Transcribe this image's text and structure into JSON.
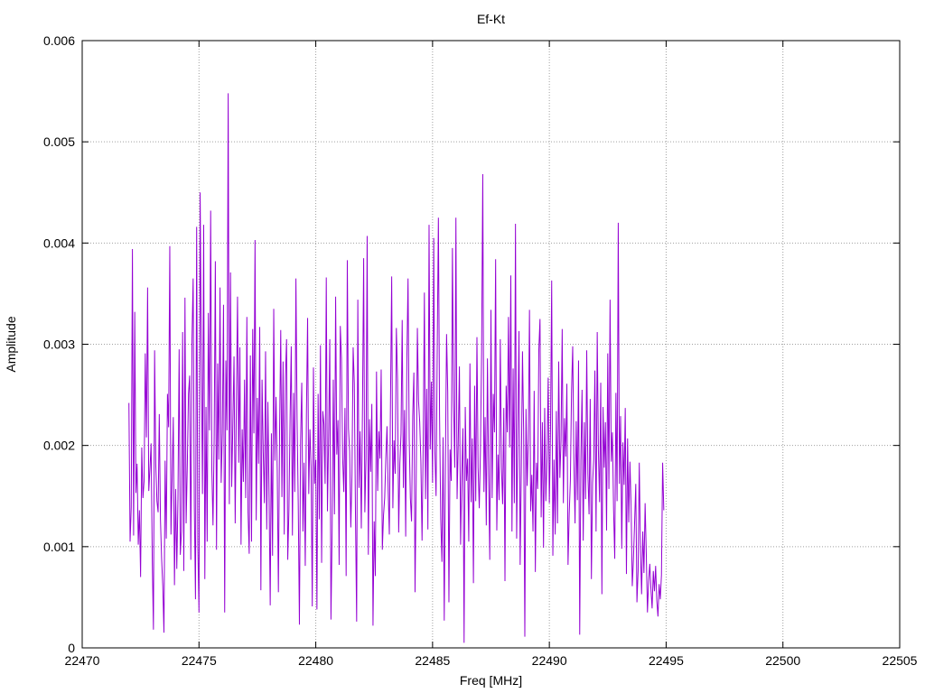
{
  "chart_data": {
    "type": "line",
    "title": "Ef-Kt",
    "xlabel": "Freq [MHz]",
    "ylabel": "Amplitude",
    "xlim": [
      22470,
      22505
    ],
    "ylim": [
      0,
      0.006
    ],
    "x_ticks": [
      "22470",
      "22475",
      "22480",
      "22485",
      "22490",
      "22495",
      "22500",
      "22505"
    ],
    "y_ticks": [
      "0",
      "0.001",
      "0.002",
      "0.003",
      "0.004",
      "0.005",
      "0.006"
    ],
    "grid": true,
    "legend": "none",
    "series": [
      {
        "color": "#9400d3",
        "x_start": 22472.0,
        "x_step": 0.05,
        "values": [
          0.00242,
          0.00105,
          0.00139,
          0.00394,
          0.00111,
          0.00332,
          0.00153,
          0.00182,
          0.00102,
          0.00136,
          0.0007,
          0.00198,
          0.00148,
          0.00165,
          0.00291,
          0.00208,
          0.00356,
          0.00155,
          0.00177,
          0.00202,
          0.00086,
          0.00018,
          0.00294,
          0.00181,
          0.00145,
          0.00134,
          0.00231,
          0.00127,
          0.00088,
          0.00061,
          0.00015,
          0.00185,
          0.00108,
          0.00251,
          0.00218,
          0.00397,
          0.00112,
          0.00168,
          0.00228,
          0.00062,
          0.00157,
          0.00078,
          0.00148,
          0.00295,
          0.00092,
          0.00115,
          0.00312,
          0.00076,
          0.00346,
          0.00123,
          0.00181,
          0.00251,
          0.00269,
          0.00087,
          0.00305,
          0.00365,
          0.00141,
          0.00048,
          0.00416,
          0.00102,
          0.00035,
          0.0045,
          0.00287,
          0.00152,
          0.00418,
          0.00068,
          0.00238,
          0.00105,
          0.00331,
          0.00215,
          0.00432,
          0.00176,
          0.00121,
          0.00208,
          0.00382,
          0.00097,
          0.00281,
          0.00186,
          0.00356,
          0.00163,
          0.00212,
          0.00339,
          0.00035,
          0.00284,
          0.00215,
          0.00548,
          0.00142,
          0.00371,
          0.00159,
          0.00221,
          0.00288,
          0.00123,
          0.00241,
          0.00347,
          0.00183,
          0.00297,
          0.00102,
          0.00216,
          0.00164,
          0.00265,
          0.00148,
          0.00327,
          0.00134,
          0.00093,
          0.00289,
          0.00105,
          0.00315,
          0.00212,
          0.00403,
          0.00126,
          0.00247,
          0.00182,
          0.00317,
          0.00057,
          0.00265,
          0.00194,
          0.00143,
          0.00293,
          0.00117,
          0.00243,
          0.00151,
          0.00042,
          0.00212,
          0.00091,
          0.00335,
          0.00185,
          0.00248,
          0.00176,
          0.00055,
          0.00212,
          0.00314,
          0.00149,
          0.00283,
          0.00112,
          0.00267,
          0.00305,
          0.00087,
          0.00136,
          0.00227,
          0.00298,
          0.00111,
          0.00252,
          0.00154,
          0.00365,
          0.00226,
          0.00141,
          0.00023,
          0.00205,
          0.00262,
          0.00115,
          0.00183,
          0.00081,
          0.00231,
          0.00326,
          0.00152,
          0.00216,
          0.00179,
          0.00041,
          0.00277,
          0.00162,
          0.00186,
          0.00038,
          0.00251,
          0.00127,
          0.00299,
          0.00084,
          0.00234,
          0.00221,
          0.00162,
          0.00366,
          0.00135,
          0.00208,
          0.00305,
          0.00028,
          0.00115,
          0.00265,
          0.00132,
          0.00347,
          0.00191,
          0.00225,
          0.00082,
          0.00318,
          0.00286,
          0.00188,
          0.00154,
          0.00237,
          0.00071,
          0.00383,
          0.00217,
          0.00194,
          0.00119,
          0.00172,
          0.00297,
          0.00261,
          0.00131,
          0.00026,
          0.00344,
          0.00158,
          0.00214,
          0.00118,
          0.00237,
          0.00385,
          0.00134,
          0.00187,
          0.00407,
          0.00092,
          0.00226,
          0.00174,
          0.00241,
          0.00022,
          0.00125,
          0.00071,
          0.00273,
          0.00155,
          0.00214,
          0.00187,
          0.00275,
          0.00097,
          0.00131,
          0.00148,
          0.00188,
          0.00219,
          0.00155,
          0.00112,
          0.00245,
          0.00367,
          0.00138,
          0.00205,
          0.00172,
          0.00316,
          0.00266,
          0.00114,
          0.00182,
          0.00212,
          0.00324,
          0.00158,
          0.00235,
          0.0011,
          0.00285,
          0.00365,
          0.00207,
          0.00148,
          0.00125,
          0.00229,
          0.00272,
          0.00055,
          0.00165,
          0.00316,
          0.00244,
          0.00223,
          0.00184,
          0.00106,
          0.00203,
          0.00351,
          0.00147,
          0.00256,
          0.00117,
          0.00418,
          0.00196,
          0.00263,
          0.00163,
          0.00405,
          0.00194,
          0.0015,
          0.00296,
          0.00425,
          0.0023,
          0.00127,
          0.00085,
          0.00208,
          0.00027,
          0.00183,
          0.0031,
          0.00253,
          0.00045,
          0.00196,
          0.00165,
          0.00395,
          0.00244,
          0.00178,
          0.00425,
          0.00147,
          0.00203,
          0.00278,
          0.00102,
          0.00169,
          0.00217,
          5e-05,
          0.00238,
          0.00165,
          0.00187,
          0.00105,
          0.00281,
          0.00144,
          0.00207,
          0.00064,
          0.00259,
          0.00145,
          0.00307,
          0.00178,
          0.00138,
          0.00195,
          0.00292,
          0.00468,
          0.00154,
          0.00228,
          0.00121,
          0.00286,
          0.00172,
          0.00087,
          0.00334,
          0.00148,
          0.00251,
          0.00213,
          0.00384,
          0.00116,
          0.00191,
          0.00146,
          0.00305,
          0.00178,
          0.00142,
          0.00237,
          0.00066,
          0.00259,
          0.00213,
          0.00327,
          0.00198,
          0.00368,
          0.00115,
          0.00276,
          0.00143,
          0.00419,
          0.00108,
          0.00213,
          0.00313,
          0.00082,
          0.00175,
          0.00293,
          0.00214,
          0.00011,
          0.00236,
          0.0016,
          0.00206,
          0.00334,
          0.00135,
          0.00171,
          0.00115,
          0.00254,
          0.00075,
          0.00183,
          0.00157,
          0.00295,
          0.00325,
          0.00129,
          0.00223,
          0.00099,
          0.00237,
          0.00145,
          0.00187,
          0.00267,
          0.00143,
          0.00215,
          0.00363,
          0.00091,
          0.00186,
          0.00112,
          0.00234,
          0.00123,
          0.00283,
          0.00168,
          0.00205,
          0.00315,
          0.00143,
          0.00227,
          0.00189,
          0.00261,
          0.00082,
          0.00132,
          0.00165,
          0.00254,
          0.00298,
          0.00187,
          0.00123,
          0.00224,
          0.00146,
          0.00284,
          0.00013,
          0.00185,
          0.00255,
          0.00106,
          0.00223,
          0.00147,
          0.00294,
          0.00172,
          0.00132,
          0.00246,
          0.00068,
          0.00163,
          0.00186,
          0.00274,
          0.00115,
          0.00312,
          0.00195,
          0.00144,
          0.00262,
          0.00053,
          0.00238,
          0.00178,
          0.00223,
          0.00116,
          0.00291,
          0.00157,
          0.00344,
          0.00184,
          0.00213,
          0.00137,
          0.00088,
          0.00252,
          0.00145,
          0.0042,
          0.00162,
          0.00229,
          0.00098,
          0.00203,
          0.00161,
          0.00237,
          0.00073,
          0.00207,
          0.00124,
          0.00184,
          0.0014,
          0.00061,
          0.00087,
          0.00124,
          0.00162,
          0.00045,
          0.00076,
          0.00183,
          0.00097,
          0.00053,
          0.00115,
          0.00074,
          0.00143,
          0.00093,
          0.00035,
          0.00066,
          0.00083,
          0.00058,
          0.00039,
          0.00076,
          0.00056,
          0.00081,
          0.00047,
          0.00031,
          0.00063,
          0.00048,
          0.00072,
          0.00183,
          0.00136
        ]
      }
    ]
  }
}
